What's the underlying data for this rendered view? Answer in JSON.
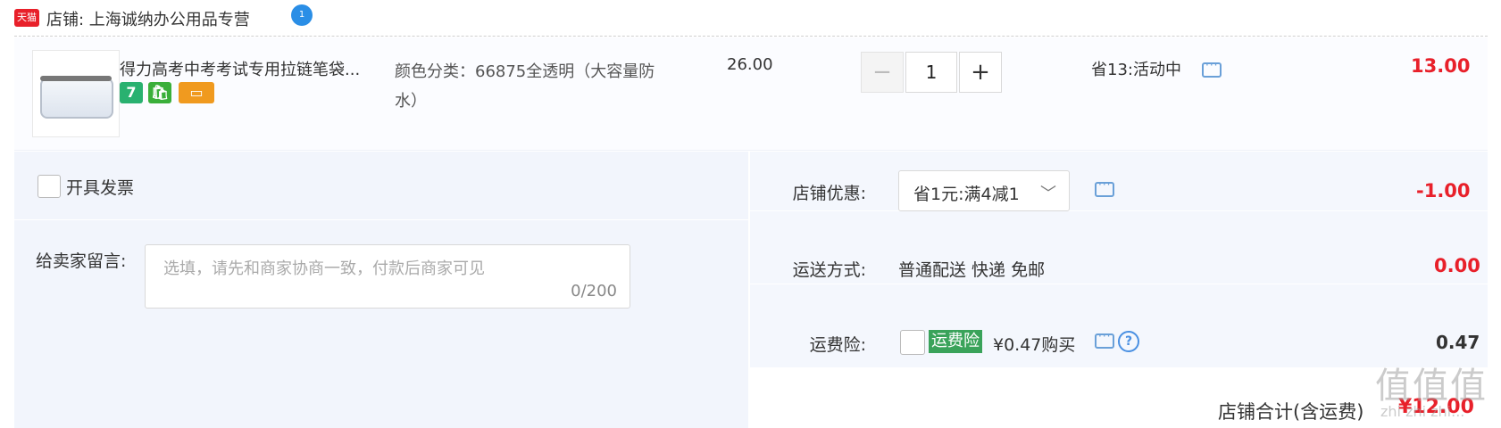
{
  "shop": {
    "logo_text": "天猫",
    "name_label": "店铺: 上海诚纳办公用品专营",
    "chat_badge": "1"
  },
  "item": {
    "title": "得力高考中考考试专用拉链笔袋...",
    "badges": [
      "7",
      "🛍",
      "▭"
    ],
    "spec": "颜色分类：66875全透明（大容量防水）",
    "price": "26.00",
    "qty_minus": "−",
    "qty": "1",
    "qty_plus": "+",
    "promo": "省13:活动中",
    "total": "13.00"
  },
  "invoice": {
    "label": "开具发票"
  },
  "message": {
    "label": "给卖家留言:",
    "placeholder": "选填，请先和商家协商一致，付款后商家可见",
    "count": "0/200"
  },
  "coupon": {
    "label": "店铺优惠:",
    "value": "省1元:满4减1",
    "chevron": "﹀",
    "amount": "-1.00"
  },
  "shipping": {
    "label": "运送方式:",
    "value": "普通配送 快递 免邮",
    "amount": "0.00"
  },
  "insurance": {
    "label": "运费险:",
    "tag": "运费险",
    "price": "¥0.47购买",
    "help": "?",
    "amount": "0.47"
  },
  "summary": {
    "label": "店铺合计(含运费)",
    "amount": "¥12.00"
  },
  "watermark": {
    "text": "值值值",
    "sub": "zhi zhi zhi..."
  }
}
